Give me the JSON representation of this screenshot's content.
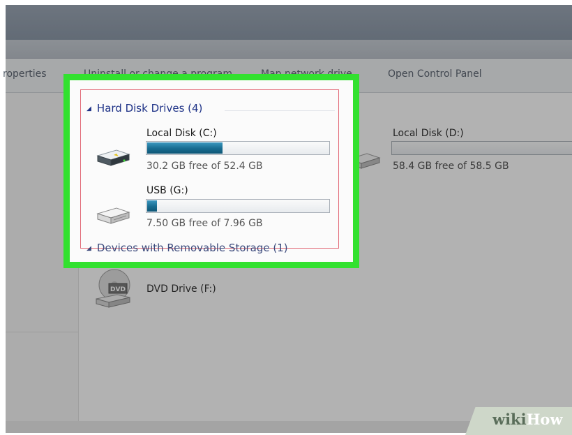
{
  "toolbar": {
    "properties": "roperties",
    "uninstall": "Uninstall or change a program",
    "map_drive": "Map network drive",
    "control_panel": "Open Control Panel"
  },
  "hard_disk_group": {
    "label": "Hard Disk Drives (4)",
    "drives": [
      {
        "name": "Local Disk (C:)",
        "free": "30.2 GB free of 52.4 GB",
        "used_fraction": 0.42
      },
      {
        "name": "USB (G:)",
        "free": "7.50 GB free of 7.96 GB",
        "used_fraction": 0.06
      },
      {
        "name": "Local Disk (D:)",
        "free": "58.4 GB free of 58.5 GB",
        "used_fraction": 0.0
      }
    ]
  },
  "removable_group": {
    "label": "Devices with Removable Storage (1)",
    "drives": [
      {
        "name": "DVD Drive (F:)",
        "icon_label": "DVD"
      }
    ]
  },
  "watermark": {
    "part1": "wiki",
    "part2": "How"
  },
  "colors": {
    "highlight": "#32e12f",
    "selection_outline": "#e26b78",
    "group_header": "#1e3287",
    "bar_fill": "#186c90"
  }
}
